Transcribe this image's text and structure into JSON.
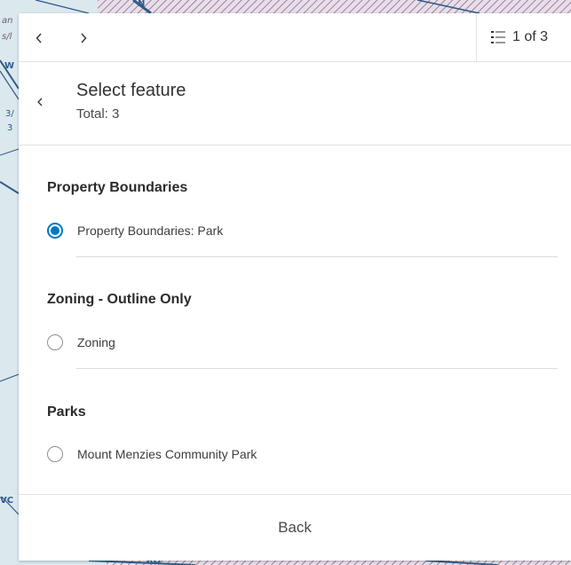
{
  "map": {
    "fragments": [
      "an",
      "s/l",
      "W",
      "3/",
      "3",
      "VC",
      "RO",
      "N"
    ]
  },
  "popup": {
    "pager": {
      "text": "1 of 3",
      "icon": "list-icon"
    },
    "nav": {
      "prev_icon": "chevron-left-icon",
      "next_icon": "chevron-right-icon"
    },
    "header": {
      "title": "Select feature",
      "subtitle": "Total: 3",
      "back_icon": "chevron-left-icon"
    },
    "groups": [
      {
        "title": "Property Boundaries",
        "options": [
          {
            "label": "Property Boundaries: Park",
            "selected": true
          }
        ]
      },
      {
        "title": "Zoning - Outline Only",
        "options": [
          {
            "label": "Zoning",
            "selected": false
          }
        ]
      },
      {
        "title": "Parks",
        "options": [
          {
            "label": "Mount Menzies Community Park",
            "selected": false
          }
        ]
      }
    ],
    "footer": {
      "back_label": "Back"
    }
  },
  "colors": {
    "accent": "#007ac2",
    "map_water": "#d9e8ef",
    "map_road": "#2f5d8a",
    "map_hatch": "#8a6a8e"
  }
}
